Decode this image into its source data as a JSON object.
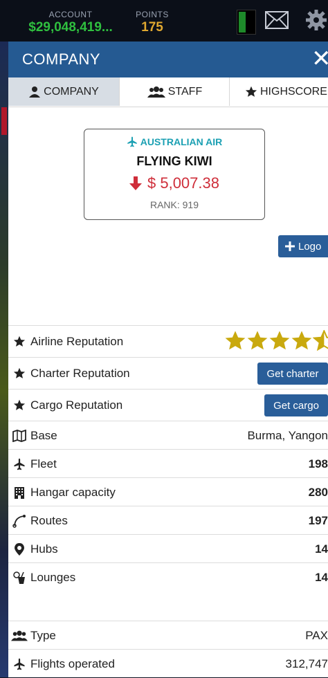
{
  "topbar": {
    "account_label": "ACCOUNT",
    "account_value": "$29,048,419...",
    "points_label": "POINTS",
    "points_value": "175",
    "icons": [
      "battery-icon",
      "mail-icon",
      "gear-icon"
    ]
  },
  "panel": {
    "title": "COMPANY",
    "close": "✕",
    "tabs": [
      {
        "label": "COMPANY",
        "icon": "person-icon",
        "active": true
      },
      {
        "label": "STAFF",
        "icon": "people-icon",
        "active": false
      },
      {
        "label": "HIGHSCORE",
        "icon": "star-icon",
        "active": false
      }
    ]
  },
  "card": {
    "airline": "AUSTRALIAN AIR",
    "name": "FLYING KIWI",
    "money": "$ 5,007.38",
    "rank": "RANK: 919"
  },
  "logo_button": "Logo",
  "rows": {
    "airline_reputation": {
      "label": "Airline Reputation",
      "stars": 4.5
    },
    "charter_reputation": {
      "label": "Charter Reputation",
      "button": "Get charter"
    },
    "cargo_reputation": {
      "label": "Cargo Reputation",
      "button": "Get cargo"
    },
    "base": {
      "label": "Base",
      "value": "Burma, Yangon"
    },
    "fleet": {
      "label": "Fleet",
      "value": "198"
    },
    "hangar": {
      "label": "Hangar capacity",
      "value": "280"
    },
    "routes": {
      "label": "Routes",
      "value": "197"
    },
    "hubs": {
      "label": "Hubs",
      "value": "14"
    },
    "lounges": {
      "label": "Lounges",
      "value": "14"
    },
    "type": {
      "label": "Type",
      "value": "PAX"
    },
    "flights": {
      "label": "Flights operated",
      "value": "312,747"
    }
  },
  "colors": {
    "header": "#255a92",
    "button": "#2a5e99",
    "account_green": "#2fbf3f",
    "points_gold": "#e0a830",
    "star_gold": "#c9a90e",
    "loss_red": "#cf2e3a",
    "airline_teal": "#1ba0b3"
  }
}
